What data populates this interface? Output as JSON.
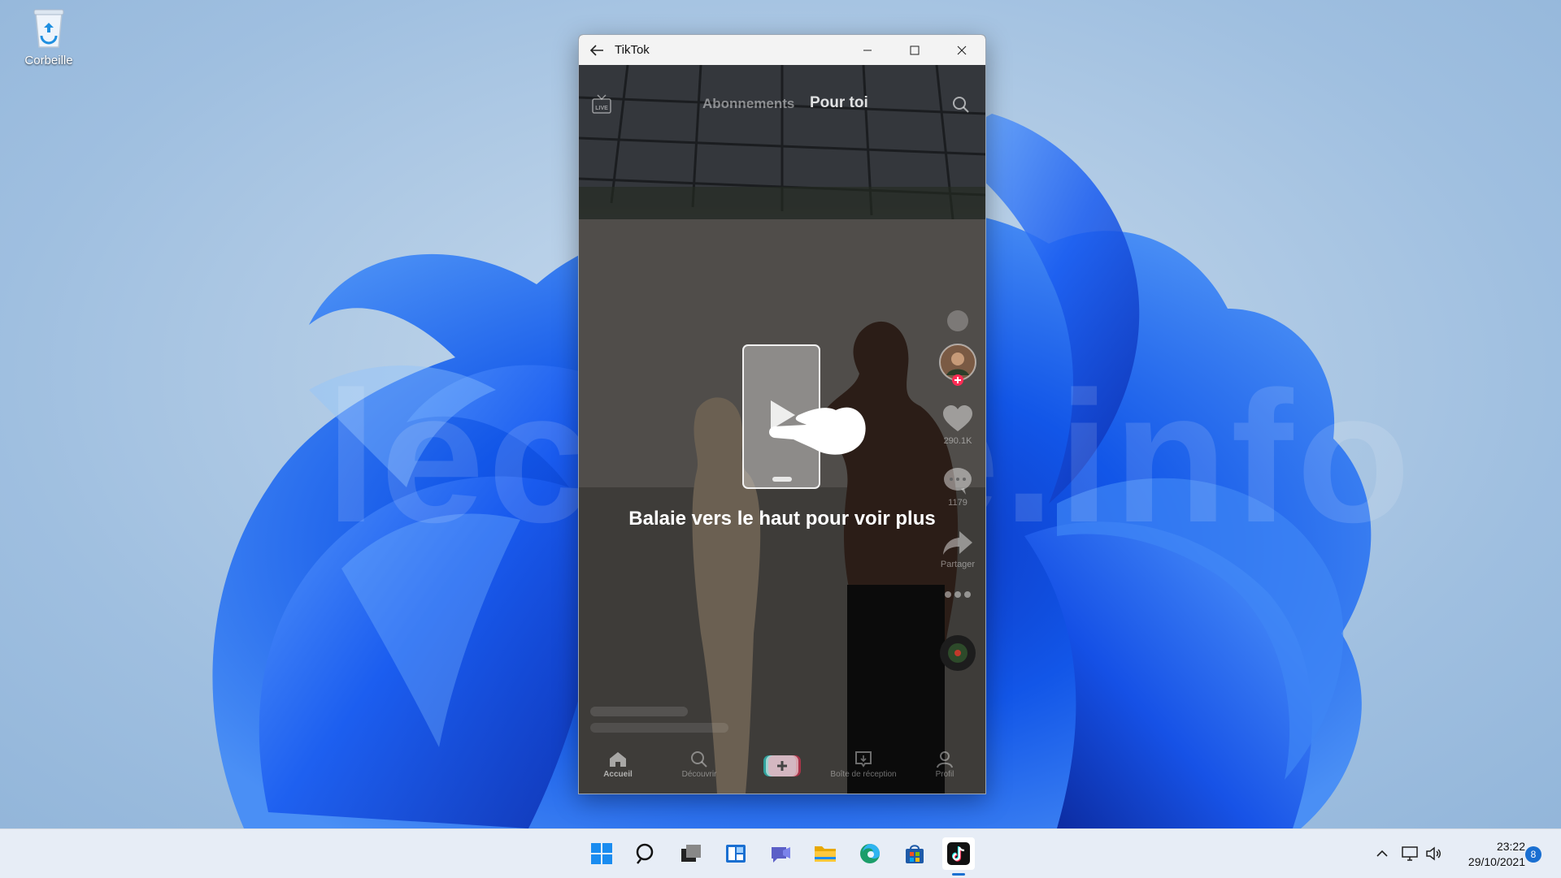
{
  "desktop": {
    "watermark": "lecrabe.info",
    "icons": [
      {
        "label": "Corbeille",
        "icon": "recycle-bin-icon"
      }
    ]
  },
  "window": {
    "title": "TikTok",
    "controls": [
      "back-arrow-icon",
      "minimize-icon",
      "maximize-icon",
      "close-icon"
    ]
  },
  "tiktok": {
    "top_nav": {
      "live_icon": "live-tv-icon",
      "tab_following": "Abonnements",
      "tab_for_you": "Pour toi",
      "search_icon": "search-icon"
    },
    "rail": {
      "likes": "290.1K",
      "comments": "1179",
      "share_label": "Partager"
    },
    "overlay": {
      "text": "Balaie vers le haut pour voir plus",
      "icon": "swipe-up-phone-hand-icon"
    },
    "bottom_nav": [
      {
        "label": "Accueil",
        "icon": "home-icon"
      },
      {
        "label": "Découvrir",
        "icon": "search-icon"
      },
      {
        "label": "",
        "icon": "create-plus-icon"
      },
      {
        "label": "Boîte de réception",
        "icon": "inbox-icon"
      },
      {
        "label": "Profil",
        "icon": "profile-icon"
      }
    ]
  },
  "taskbar": {
    "apps": [
      "start-icon",
      "search-icon",
      "task-view-icon",
      "widgets-icon",
      "chat-icon",
      "file-explorer-icon",
      "edge-icon",
      "store-icon",
      "tiktok-icon"
    ],
    "time": "23:22",
    "date": "29/10/2021",
    "notification_count": "8"
  },
  "colors": {
    "accent": "#1a6fd1",
    "tiktok_red": "#fe2c55",
    "tiktok_cyan": "#25f4ee"
  }
}
